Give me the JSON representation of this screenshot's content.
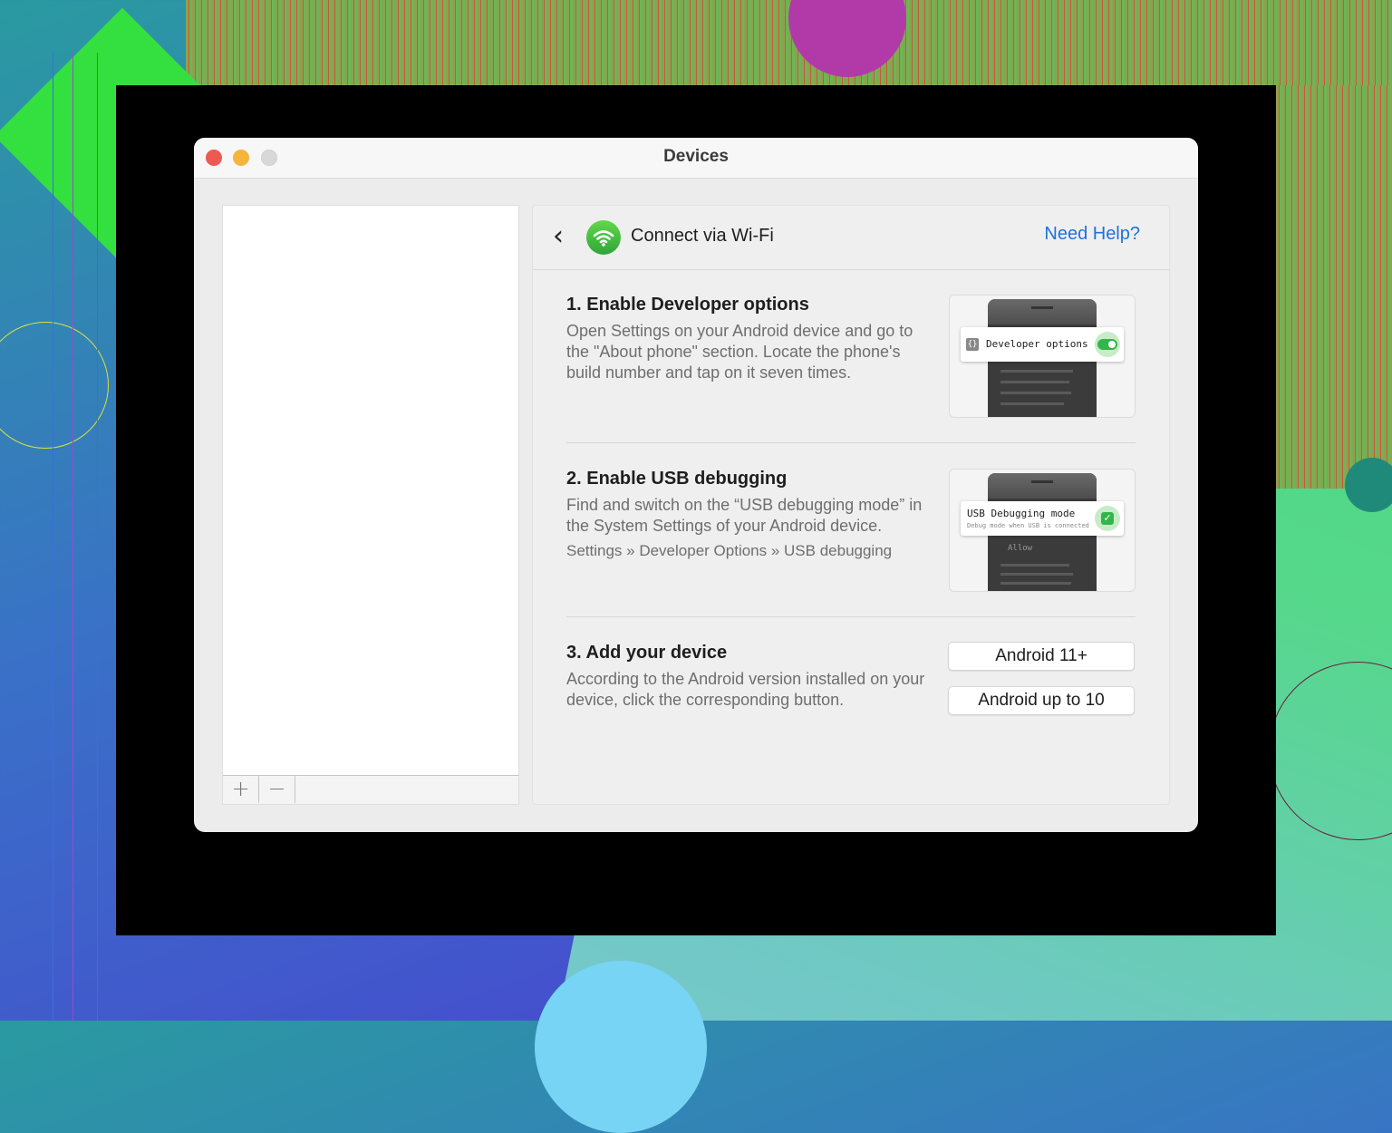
{
  "window": {
    "title": "Devices"
  },
  "sidebar": {
    "add_symbol": "+",
    "remove_symbol": "−"
  },
  "header": {
    "back_icon": "chevron-left-icon",
    "back_symbol": "‹",
    "wifi_icon": "wifi-icon",
    "title": "Connect via Wi-Fi",
    "help_link": "Need Help?"
  },
  "steps": [
    {
      "title": "1. Enable Developer options",
      "description": "Open Settings on your Android device and go to the \"About phone\" section. Locate the phone's build number and tap on it seven times.",
      "illustration": {
        "label": "Developer options",
        "icon_text": "{}",
        "toggle_on": true
      }
    },
    {
      "title": "2. Enable USB debugging",
      "description": "Find and switch on the “USB debugging mode” in the System Settings of your Android device.",
      "path": "Settings » Developer Options » USB debugging",
      "illustration": {
        "label": "USB Debugging mode",
        "sublabel": "Debug mode when USB is connected",
        "check_symbol": "✓",
        "allow_text": "Allow"
      }
    },
    {
      "title": "3. Add your device",
      "description": "According to the Android version installed on your device, click the corresponding button.",
      "buttons": [
        "Android 11+",
        "Android up to 10"
      ]
    }
  ],
  "colors": {
    "accent_link": "#1d73d8",
    "toggle_green": "#34b54a",
    "close": "#ee5a52",
    "minimize": "#f5b43a",
    "zoom_disabled": "#d8d8d8"
  }
}
